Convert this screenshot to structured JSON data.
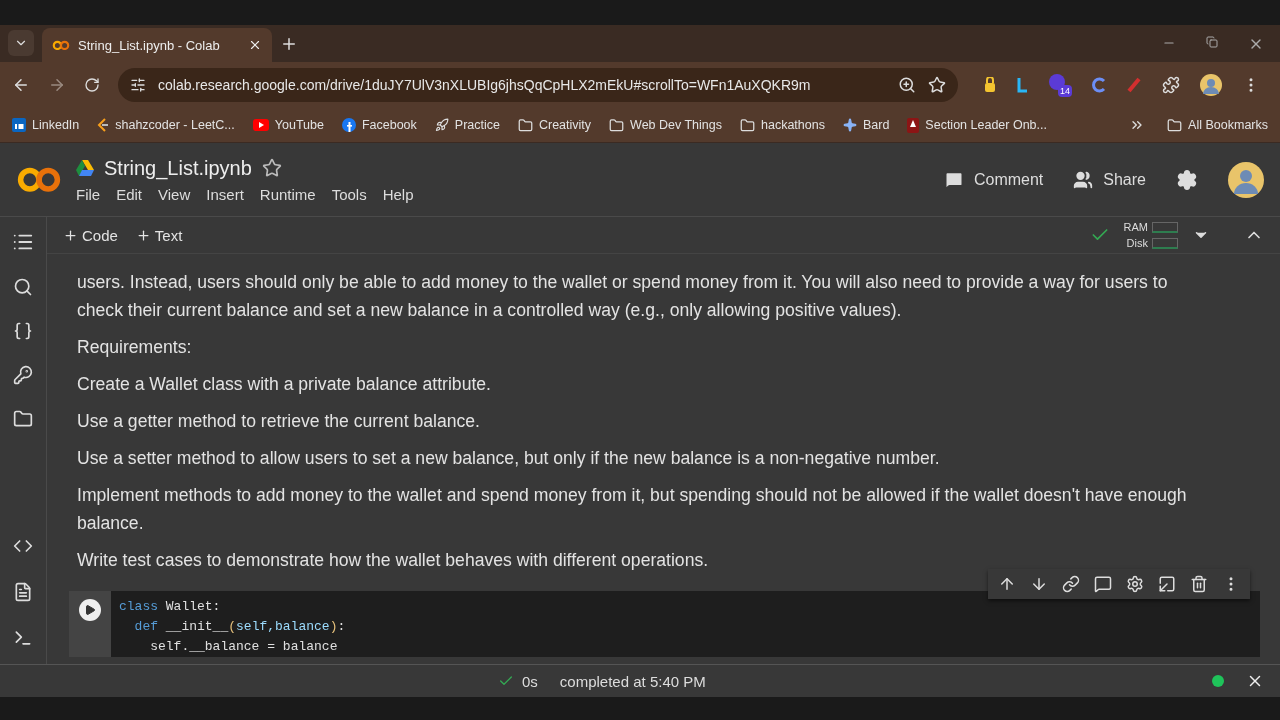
{
  "browser": {
    "tabs": [
      {
        "title": "String_List.ipynb - Colab",
        "selected": true
      }
    ],
    "url": "colab.research.google.com/drive/1duJY7UlV3nXLUBIg6jhsQqCpHLX2mEkU#scrollTo=WFn1AuXQKR9m",
    "extension_badge": "14",
    "bookmarks": [
      {
        "label": "LinkedIn",
        "kind": "linkedin"
      },
      {
        "label": "shahzcoder - LeetC...",
        "kind": "leetcode"
      },
      {
        "label": "YouTube",
        "kind": "youtube"
      },
      {
        "label": "Facebook",
        "kind": "facebook"
      },
      {
        "label": "Practice",
        "kind": "rocket"
      },
      {
        "label": "Creativity",
        "kind": "folder"
      },
      {
        "label": "Web Dev Things",
        "kind": "folder"
      },
      {
        "label": "hackathons",
        "kind": "folder"
      },
      {
        "label": "Bard",
        "kind": "sparkle"
      },
      {
        "label": "Section Leader Onb...",
        "kind": "tree"
      }
    ],
    "all_bookmarks": "All Bookmarks"
  },
  "notebook": {
    "title": "String_List.ipynb",
    "starred": false,
    "menu": [
      "File",
      "Edit",
      "View",
      "Insert",
      "Runtime",
      "Tools",
      "Help"
    ],
    "actions": [
      {
        "label": "Comment",
        "kind": "comment"
      },
      {
        "label": "Share",
        "kind": "share"
      }
    ],
    "add_buttons": [
      "Code",
      "Text"
    ],
    "connected": true,
    "resources": [
      "RAM",
      "Disk"
    ],
    "paragraphs": [
      "users. Instead, users should only be able to add money to the wallet or spend money from it. You will also need to provide a way for users to check their current balance and set a new balance in a controlled way (e.g., only allowing positive values).",
      "Requirements:",
      "Create a Wallet class with a private balance attribute.",
      "Use a getter method to retrieve the current balance.",
      "Use a setter method to allow users to set a new balance, but only if the new balance is a non-negative number.",
      "Implement methods to add money to the wallet and spend money from it, but spending should not be allowed if the wallet doesn't have enough balance.",
      "Write test cases to demonstrate how the wallet behaves with different operations."
    ],
    "code_lines": [
      [
        {
          "t": "class",
          "kind": "keyword"
        },
        {
          "t": " Wallet:",
          "kind": "plain"
        }
      ],
      [
        {
          "t": "  def",
          "kind": "keyword"
        },
        {
          "t": " __init__",
          "kind": "plain"
        },
        {
          "t": "(",
          "kind": "bracket"
        },
        {
          "t": "self,balance",
          "kind": "param"
        },
        {
          "t": ")",
          "kind": "bracket"
        },
        {
          "t": ":",
          "kind": "plain"
        }
      ],
      [
        {
          "t": "    self.__balance = balance",
          "kind": "plain"
        }
      ]
    ]
  },
  "status_bar": {
    "duration": "0s",
    "message": "completed at 5:40 PM"
  }
}
